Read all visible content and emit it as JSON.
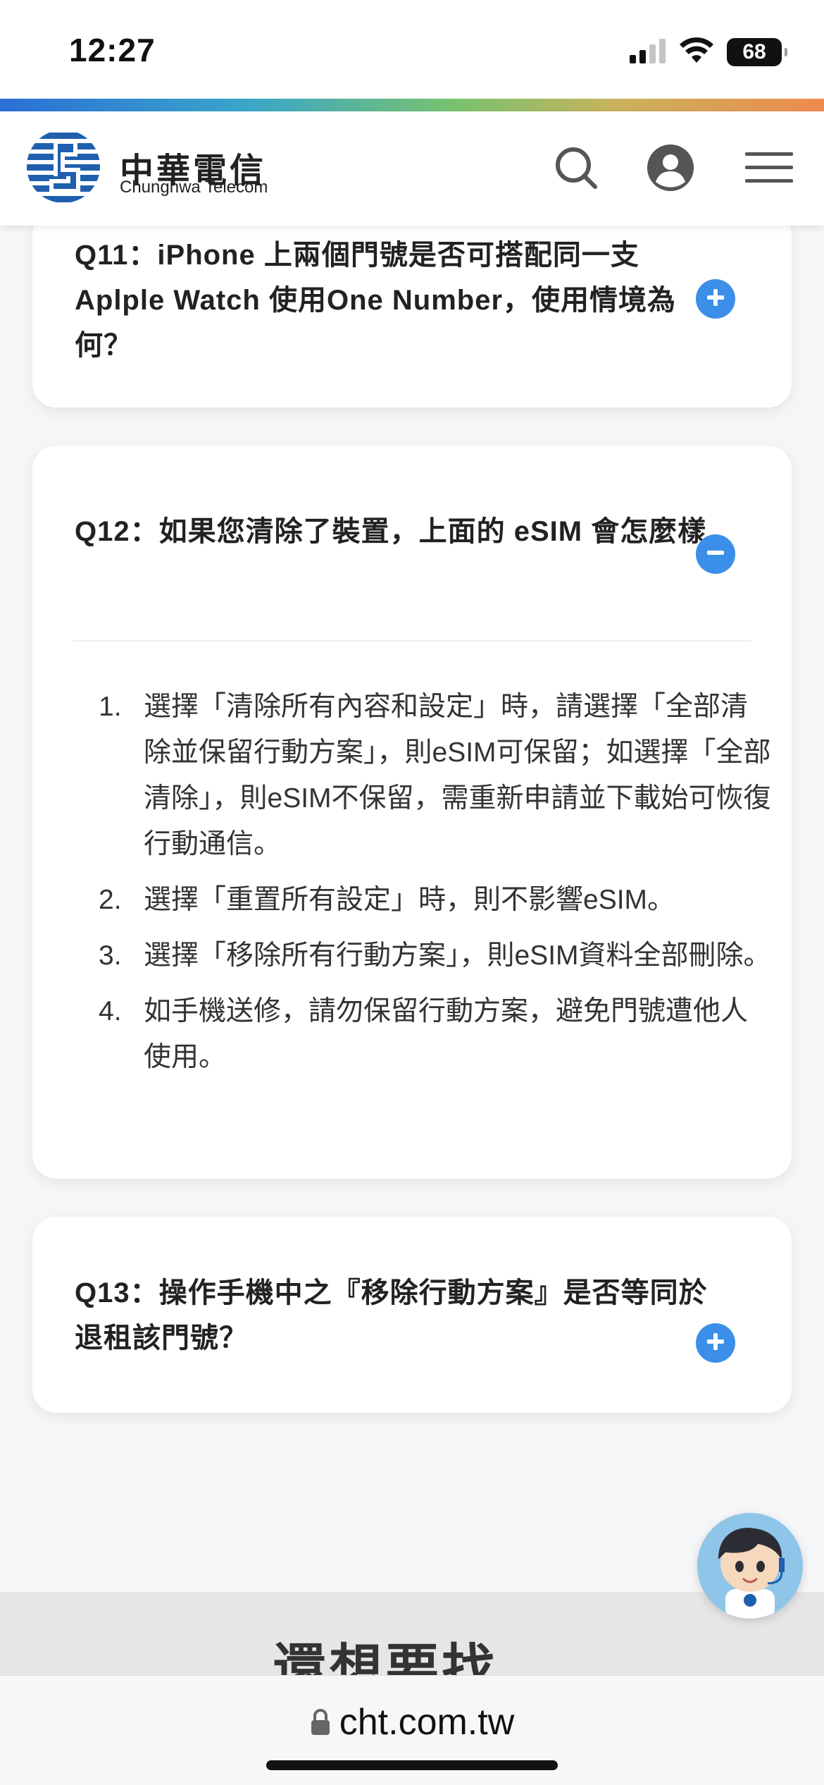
{
  "status_bar": {
    "time": "12:27",
    "battery": "68"
  },
  "header": {
    "logo_cn": "中華電信",
    "logo_en": "Chunghwa Telecom"
  },
  "faq": [
    {
      "question": "Q11：iPhone 上兩個門號是否可搭配同一支 Aplple Watch 使用One Number，使用情境為何？",
      "expanded": false
    },
    {
      "question": "Q12：如果您清除了裝置，上面的 eSIM 會怎麼樣",
      "expanded": true,
      "answers": [
        {
          "num": "1.",
          "text": "選擇「清除所有內容和設定」時，請選擇「全部清除並保留行動方案」，則eSIM可保留；如選擇「全部清除」，則eSIM不保留，需重新申請並下載始可恢復行動通信。"
        },
        {
          "num": "2.",
          "text": "選擇「重置所有設定」時，則不影響eSIM。"
        },
        {
          "num": "3.",
          "text": "選擇「移除所有行動方案」，則eSIM資料全部刪除。"
        },
        {
          "num": "4.",
          "text": "如手機送修，請勿保留行動方案，避免門號遭他人使用。"
        }
      ]
    },
    {
      "question": "Q13：操作手機中之『移除行動方案』是否等同於退租該門號？",
      "expanded": false
    }
  ],
  "more": {
    "title": "還想要找..."
  },
  "browser": {
    "url": "cht.com.tw"
  },
  "colors": {
    "accent": "#3b8fe8",
    "brand_blue": "#1f5fae"
  }
}
